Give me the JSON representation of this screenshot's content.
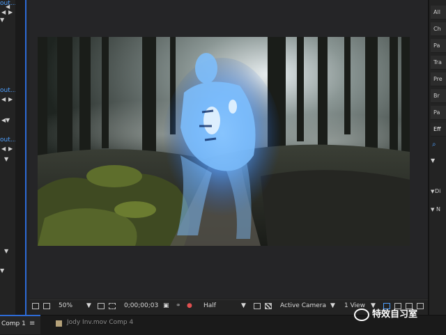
{
  "left_panel": {
    "items": [
      {
        "text": "out..."
      },
      {
        "text": "out..."
      },
      {
        "text": "out..."
      }
    ]
  },
  "viewer_toolbar": {
    "zoom": "50%",
    "timecode": "0;00;00;03",
    "resolution": "Half",
    "camera": "Active Camera",
    "views": "1 View"
  },
  "right_panel": {
    "items": [
      "All",
      "Ch",
      "Pa",
      "Tra",
      "Pre",
      "Br",
      "Pa",
      "Eff"
    ],
    "search_placeholder": "",
    "sections": [
      "Di",
      "N"
    ]
  },
  "tabs": [
    {
      "label": "Comp 1",
      "active": true
    },
    {
      "label": "Jody Inv.mov Comp 4",
      "active": false
    }
  ],
  "watermark": {
    "text": "特效自习室"
  },
  "colors": {
    "accent": "#2d6bd6",
    "glow": "#6fb4ff"
  }
}
